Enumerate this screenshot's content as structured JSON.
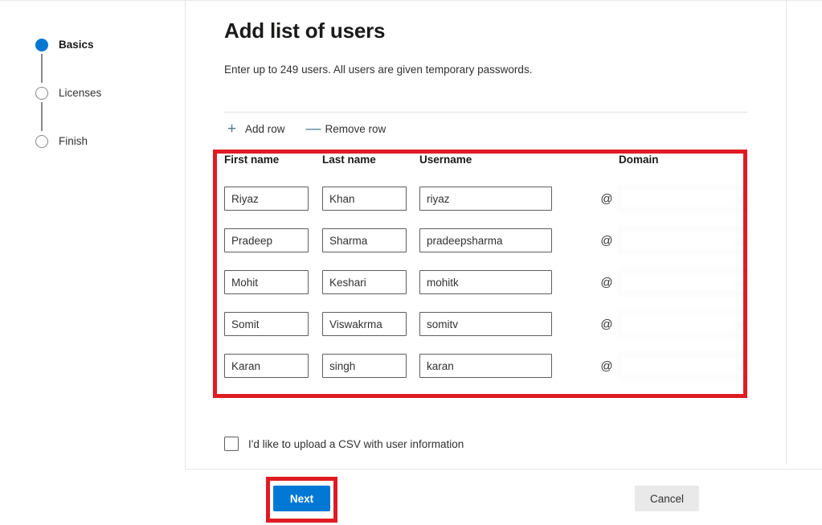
{
  "wizard": {
    "steps": [
      {
        "label": "Basics",
        "state": "current"
      },
      {
        "label": "Licenses",
        "state": "upcoming"
      },
      {
        "label": "Finish",
        "state": "upcoming"
      }
    ]
  },
  "header": {
    "title": "Add list of users",
    "subtitle": "Enter up to 249 users. All users are given temporary passwords.",
    "max_users": 249
  },
  "row_commands": {
    "add": {
      "label": "Add row",
      "glyph": "+",
      "icon": "plus-icon"
    },
    "remove": {
      "label": "Remove row",
      "glyph": "—",
      "icon": "minus-icon"
    }
  },
  "grid": {
    "columns": [
      "First name",
      "Last name",
      "Username",
      "Domain"
    ],
    "at_symbol": "@",
    "domain_placeholder": "",
    "chevron": "⌄",
    "rows": [
      {
        "first_name": "Riyaz",
        "last_name": "Khan",
        "username": "riyaz",
        "domain": ""
      },
      {
        "first_name": "Pradeep",
        "last_name": "Sharma",
        "username": "pradeepsharma",
        "domain": ""
      },
      {
        "first_name": "Mohit",
        "last_name": "Keshari",
        "username": "mohitk",
        "domain": ""
      },
      {
        "first_name": "Somit",
        "last_name": "Viswakrma",
        "username": "somitv",
        "domain": ""
      },
      {
        "first_name": "Karan",
        "last_name": "singh",
        "username": "karan",
        "domain": ""
      }
    ]
  },
  "csv": {
    "label": "I'd like to upload a CSV with user information",
    "checked": false
  },
  "footer": {
    "next_label": "Next",
    "cancel_label": "Cancel"
  },
  "colors": {
    "accent": "#0078d4",
    "annotation": "#e01b24",
    "command_icon": "#4a7b8c",
    "cancel_bg": "#e9e9e9",
    "field_border": "#605e5c"
  }
}
